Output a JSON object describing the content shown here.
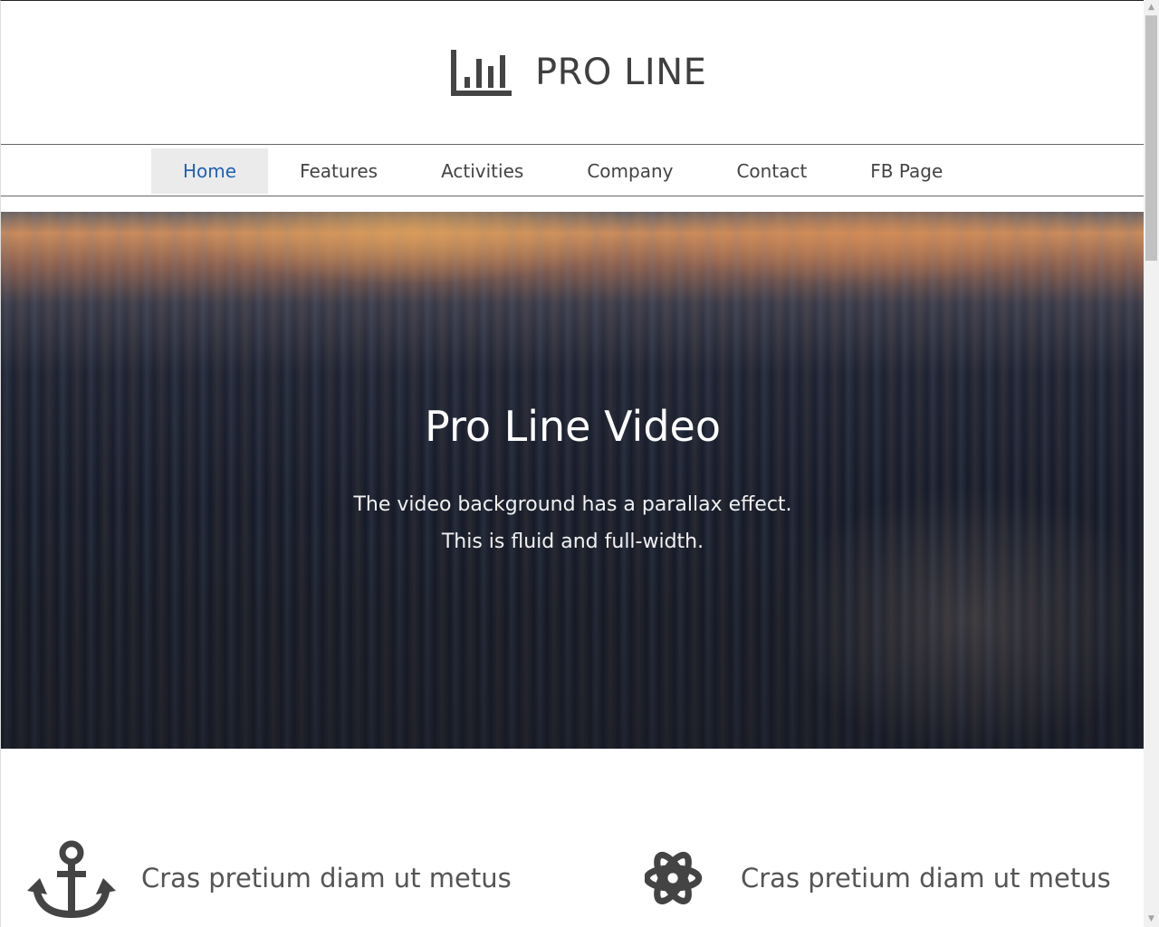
{
  "brand": {
    "name": "PRO LINE",
    "logo_icon": "bar-chart-icon"
  },
  "nav": {
    "items": [
      {
        "label": "Home",
        "active": true
      },
      {
        "label": "Features",
        "active": false
      },
      {
        "label": "Activities",
        "active": false
      },
      {
        "label": "Company",
        "active": false
      },
      {
        "label": "Contact",
        "active": false
      },
      {
        "label": "FB Page",
        "active": false
      }
    ]
  },
  "hero": {
    "title": "Pro Line Video",
    "subtitle_line1": "The video background has a parallax effect.",
    "subtitle_line2": "This is fluid and full-width."
  },
  "features": [
    {
      "icon": "anchor-icon",
      "title": "Cras pretium diam ut metus"
    },
    {
      "icon": "atom-icon",
      "title": "Cras pretium diam ut metus"
    }
  ],
  "colors": {
    "nav_active_text": "#1f62b4",
    "nav_active_bg": "#ebebeb",
    "icon_color": "#444444"
  }
}
